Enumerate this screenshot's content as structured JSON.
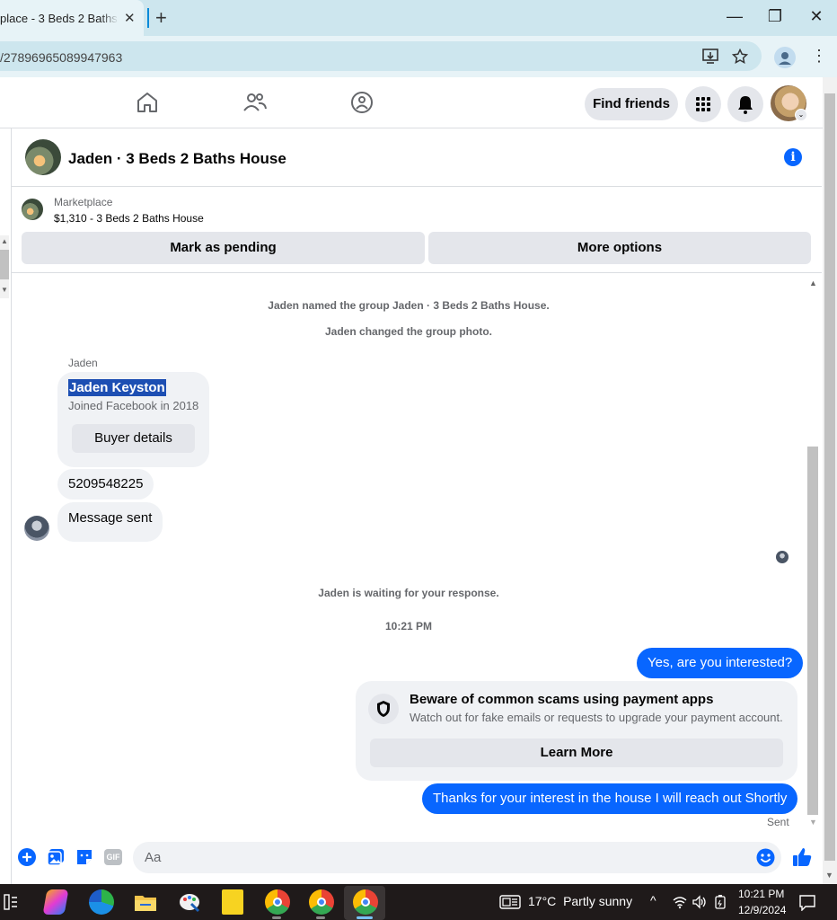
{
  "browser": {
    "tab_title": "place - 3 Beds 2 Baths H",
    "tab_close": "✕",
    "new_tab": "+",
    "url": "/27896965089947963",
    "window_controls": {
      "minimize": "—",
      "maximize": "❐",
      "close": "✕"
    }
  },
  "nav": {
    "find_friends": "Find friends"
  },
  "chat": {
    "title": "Jaden · 3 Beds 2 Baths House",
    "info_icon": "i",
    "marketplace_label": "Marketplace",
    "listing": "$1,310 - 3 Beds 2 Baths House",
    "mark_pending": "Mark as pending",
    "more_options": "More options"
  },
  "messages": {
    "system_1": "Jaden named the group Jaden · 3 Beds 2 Baths House.",
    "system_2": "Jaden changed the group photo.",
    "sender": "Jaden",
    "card_name": "Jaden Keyston",
    "card_joined": "Joined Facebook in 2018",
    "buyer_details": "Buyer details",
    "msg_phone": "5209548225",
    "msg_sent": "Message sent",
    "waiting": "Jaden is waiting for your response.",
    "time": "10:21 PM",
    "out_1": "Yes, are you interested?",
    "scam_title": "Beware of common scams using payment apps",
    "scam_sub": "Watch out for fake emails or requests to upgrade your payment account.",
    "learn_more": "Learn More",
    "out_2": "Thanks for your interest in the house I will reach out Shortly",
    "status": "Sent"
  },
  "composer": {
    "placeholder": "Aa",
    "gif": "GIF"
  },
  "taskbar": {
    "temperature": "17°C",
    "weather": "Partly sunny",
    "time": "10:21 PM",
    "date": "12/9/2024"
  },
  "colors": {
    "accent": "#0866ff",
    "tab_strip": "#cde6ee",
    "bubble_in": "#f0f2f5"
  }
}
